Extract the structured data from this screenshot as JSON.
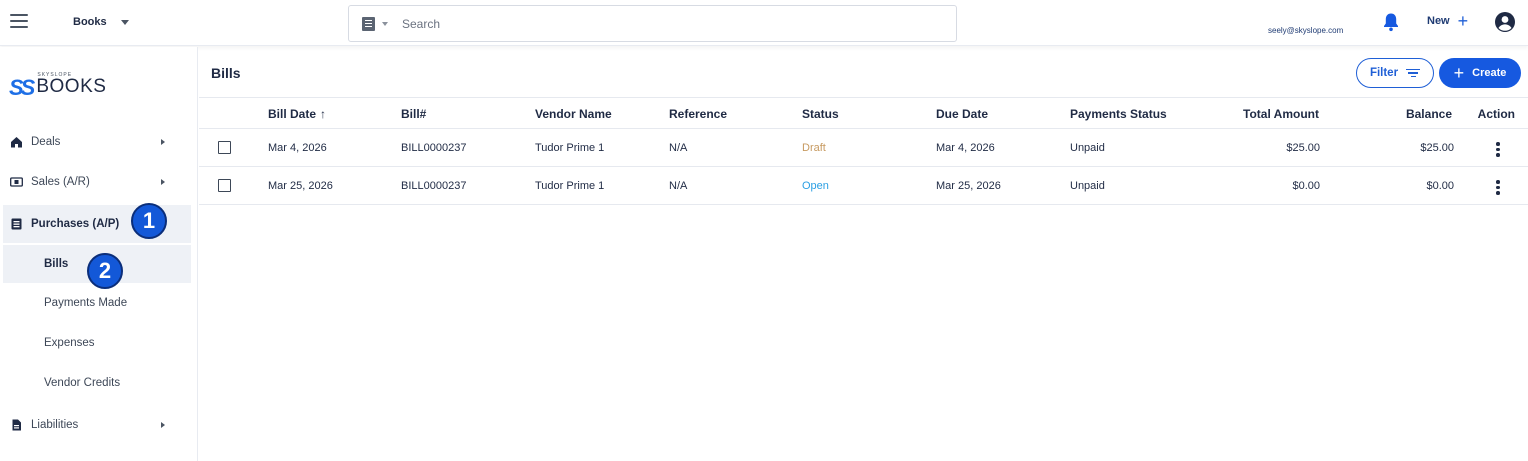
{
  "topbar": {
    "app_name": "Books",
    "search_placeholder": "Search",
    "user_email": "seely@skyslope.com",
    "new_label": "New"
  },
  "logo": {
    "small_text": "SKYSLOPE",
    "word": "BOOKS"
  },
  "sidebar": {
    "items": [
      {
        "label": "Deals",
        "icon": "house-icon"
      },
      {
        "label": "Sales (A/R)",
        "icon": "money-icon"
      },
      {
        "label": "Purchases (A/P)",
        "icon": "receipt-icon"
      },
      {
        "label": "Liabilities",
        "icon": "document-icon"
      }
    ],
    "sub_items": [
      "Bills",
      "Payments Made",
      "Expenses",
      "Vendor Credits"
    ]
  },
  "annotations": {
    "badge1": "1",
    "badge2": "2"
  },
  "main": {
    "title": "Bills",
    "filter_label": "Filter",
    "create_label": "Create"
  },
  "table": {
    "columns": [
      "Bill Date",
      "Bill#",
      "Vendor Name",
      "Reference",
      "Status",
      "Due Date",
      "Payments Status",
      "Total Amount",
      "Balance",
      "Action"
    ],
    "sort_indicator": "↑",
    "rows": [
      {
        "bill_date": "Mar 4, 2026",
        "bill_no": "BILL0000237",
        "vendor": "Tudor Prime 1",
        "reference": "N/A",
        "status": "Draft",
        "due_date": "Mar 4, 2026",
        "payment_status": "Unpaid",
        "total": "$25.00",
        "balance": "$25.00"
      },
      {
        "bill_date": "Mar 25, 2026",
        "bill_no": "BILL0000237",
        "vendor": "Tudor Prime 1",
        "reference": "N/A",
        "status": "Open",
        "due_date": "Mar 25, 2026",
        "payment_status": "Unpaid",
        "total": "$0.00",
        "balance": "$0.00"
      }
    ]
  },
  "colors": {
    "primary": "#1659e0",
    "draft": "#c79a60",
    "open": "#2b9fe3",
    "active_bg": "#eef1f6"
  }
}
